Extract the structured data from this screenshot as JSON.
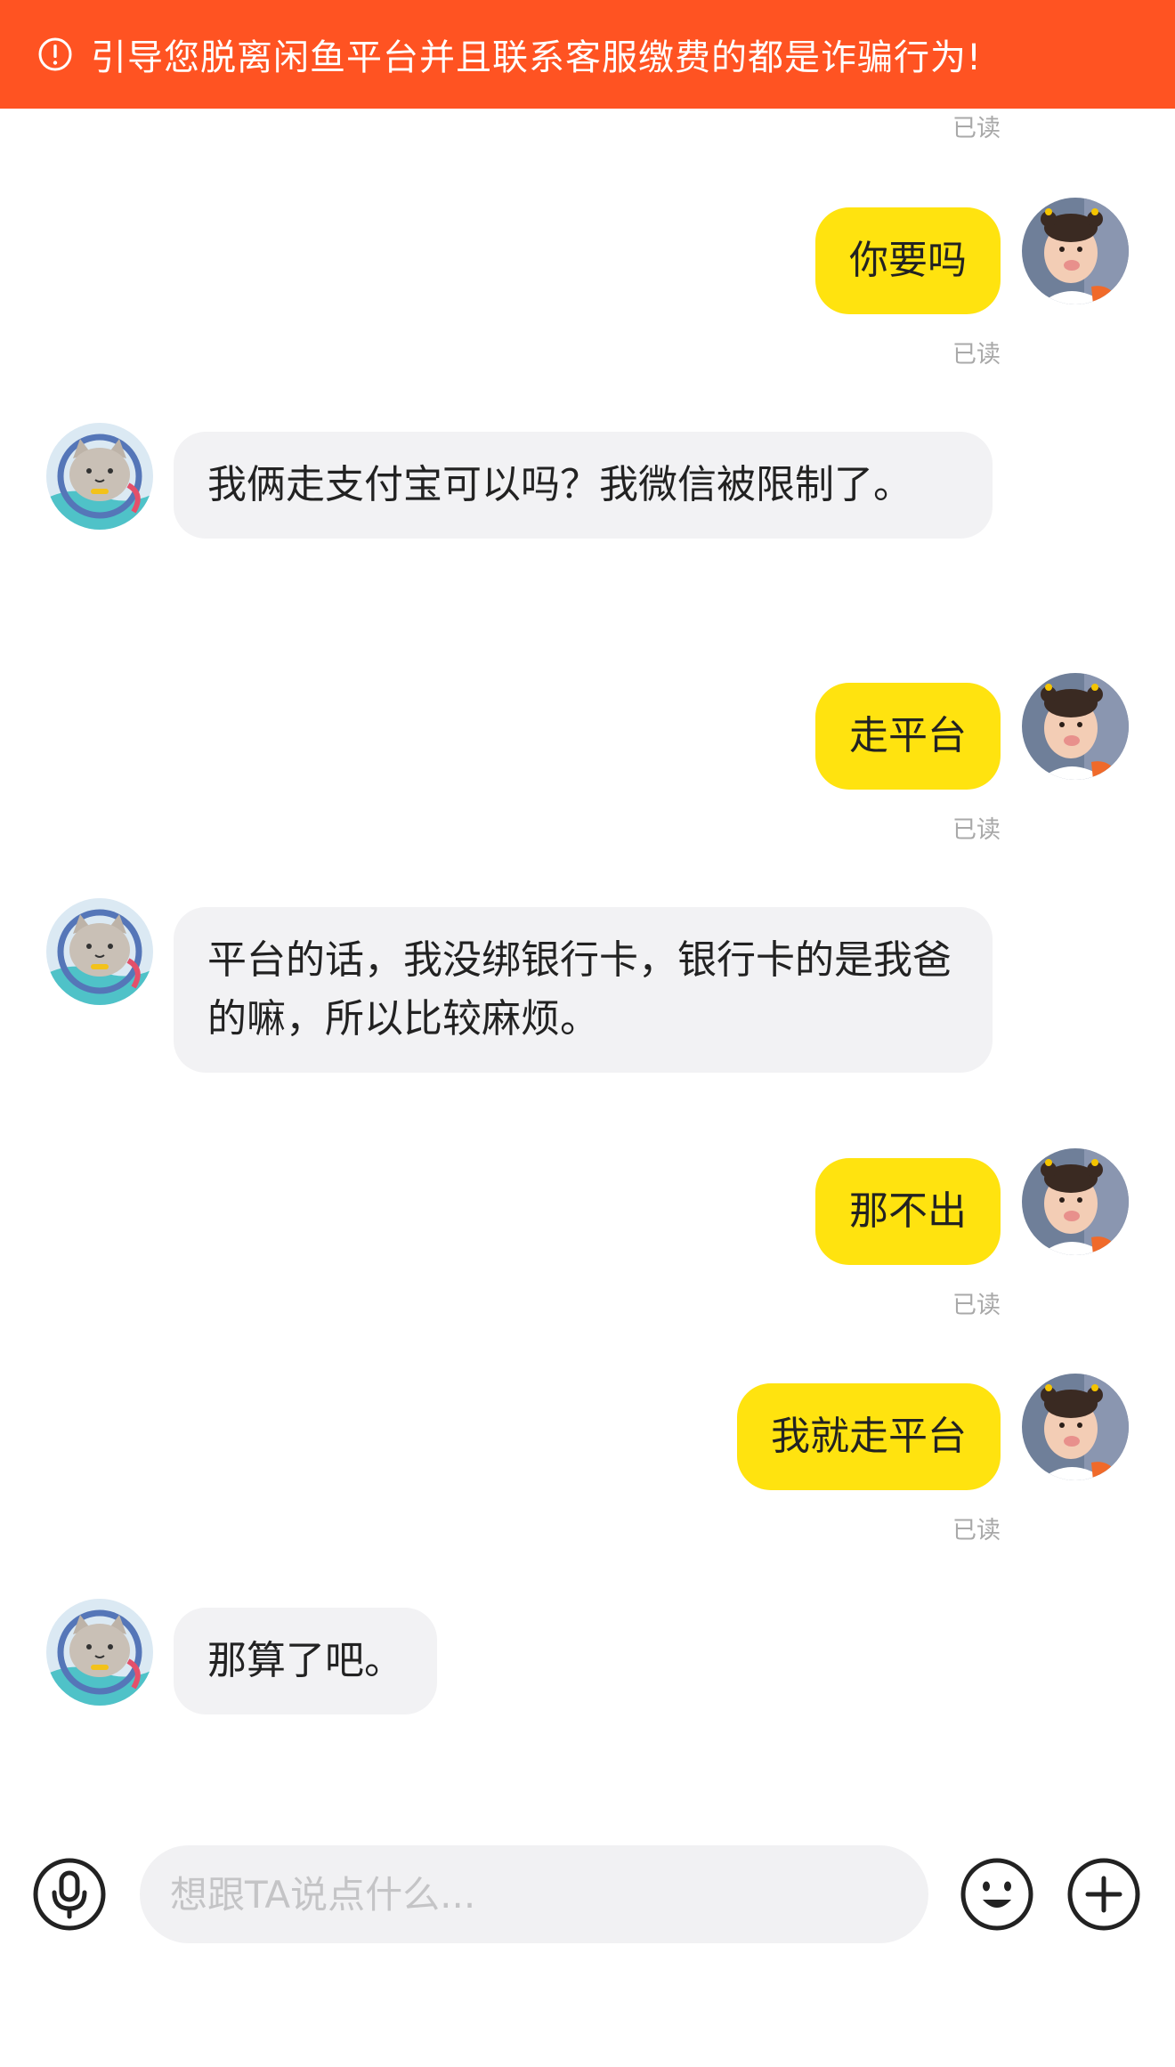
{
  "banner": {
    "text": "引导您脱离闲鱼平台并且联系客服缴费的都是诈骗行为!",
    "icon": "alert-circle-icon",
    "color": "#ff5322"
  },
  "read_label": "已读",
  "messages": [
    {
      "from": "me",
      "text": "你要吗",
      "read": "已读"
    },
    {
      "from": "other",
      "text": "我俩走支付宝可以吗？我微信被限制了。"
    },
    {
      "from": "me",
      "text": "走平台",
      "read": "已读"
    },
    {
      "from": "other",
      "text": "平台的话，我没绑银行卡，银行卡的是我爸的嘛，所以比较麻烦。"
    },
    {
      "from": "me",
      "text": "那不出",
      "read": "已读"
    },
    {
      "from": "me",
      "text": "我就走平台",
      "read": "已读"
    },
    {
      "from": "other",
      "text": "那算了吧。"
    }
  ],
  "composer": {
    "placeholder": "想跟TA说点什么...",
    "voice_icon": "microphone-icon",
    "emoji_icon": "emoji-icon",
    "plus_icon": "plus-circle-icon"
  },
  "colors": {
    "my_bubble": "#ffe30f",
    "their_bubble": "#f2f2f4",
    "read_text": "#a9a9a9"
  }
}
